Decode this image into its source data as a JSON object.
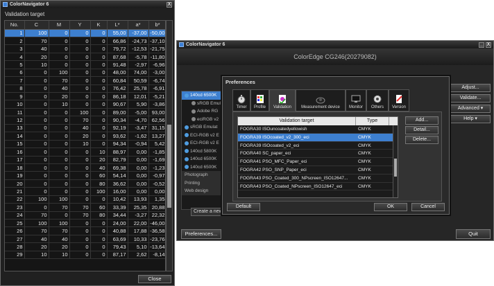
{
  "window_a": {
    "title": "ColorNavigator 6",
    "label": "Validation target",
    "close_label": "Close",
    "min_btn": "_",
    "x_btn": "X",
    "columns": [
      "No.",
      "C",
      "M",
      "Y",
      "K",
      "L*",
      "a*",
      "b*"
    ],
    "rows": [
      [
        "1",
        "100",
        "0",
        "0",
        "0",
        "55,00",
        "-37,00",
        "-50,00"
      ],
      [
        "2",
        "70",
        "0",
        "0",
        "0",
        "66,86",
        "-24,73",
        "-37,10"
      ],
      [
        "3",
        "40",
        "0",
        "0",
        "0",
        "79,72",
        "-12,53",
        "-21,75"
      ],
      [
        "4",
        "20",
        "0",
        "0",
        "0",
        "87,68",
        "-5,78",
        "-11,80"
      ],
      [
        "5",
        "10",
        "0",
        "0",
        "0",
        "91,48",
        "-2,97",
        "-6,96"
      ],
      [
        "6",
        "0",
        "100",
        "0",
        "0",
        "48,00",
        "74,00",
        "-3,00"
      ],
      [
        "7",
        "0",
        "70",
        "0",
        "0",
        "60,84",
        "50,59",
        "-6,74"
      ],
      [
        "8",
        "0",
        "40",
        "0",
        "0",
        "76,42",
        "25,78",
        "-6,91"
      ],
      [
        "9",
        "0",
        "20",
        "0",
        "0",
        "86,18",
        "12,01",
        "-5,21"
      ],
      [
        "10",
        "0",
        "10",
        "0",
        "0",
        "90,67",
        "5,90",
        "-3,86"
      ],
      [
        "11",
        "0",
        "0",
        "100",
        "0",
        "89,00",
        "-5,00",
        "93,00"
      ],
      [
        "12",
        "0",
        "0",
        "70",
        "0",
        "90,34",
        "-4,70",
        "62,56"
      ],
      [
        "13",
        "0",
        "0",
        "40",
        "0",
        "92,19",
        "-3,47",
        "31,15"
      ],
      [
        "14",
        "0",
        "0",
        "20",
        "0",
        "93,62",
        "-1,62",
        "13,27"
      ],
      [
        "15",
        "0",
        "0",
        "10",
        "0",
        "94,34",
        "-0,94",
        "5,42"
      ],
      [
        "16",
        "0",
        "0",
        "0",
        "10",
        "88,97",
        "0,00",
        "-1,85"
      ],
      [
        "17",
        "0",
        "0",
        "0",
        "20",
        "82,79",
        "0,00",
        "-1,69"
      ],
      [
        "18",
        "0",
        "0",
        "0",
        "40",
        "69,38",
        "0,00",
        "-1,23"
      ],
      [
        "19",
        "0",
        "0",
        "0",
        "60",
        "54,14",
        "0,00",
        "-0,97"
      ],
      [
        "20",
        "0",
        "0",
        "0",
        "80",
        "36,62",
        "0,00",
        "-0,52"
      ],
      [
        "21",
        "0",
        "0",
        "0",
        "100",
        "16,00",
        "0,00",
        "0,00"
      ],
      [
        "22",
        "100",
        "100",
        "0",
        "0",
        "10,42",
        "13,93",
        "1,35"
      ],
      [
        "23",
        "0",
        "70",
        "70",
        "60",
        "33,39",
        "25,35",
        "20,88"
      ],
      [
        "24",
        "70",
        "0",
        "70",
        "80",
        "34,44",
        "-3,27",
        "22,32"
      ],
      [
        "25",
        "100",
        "100",
        "0",
        "0",
        "24,00",
        "22,00",
        "-46,00"
      ],
      [
        "26",
        "70",
        "70",
        "0",
        "0",
        "40,88",
        "17,88",
        "-36,58"
      ],
      [
        "27",
        "40",
        "40",
        "0",
        "0",
        "63,69",
        "10,33",
        "-23,76"
      ],
      [
        "28",
        "20",
        "20",
        "0",
        "0",
        "79,43",
        "5,10",
        "-13,64"
      ],
      [
        "29",
        "10",
        "10",
        "0",
        "0",
        "87,17",
        "2,62",
        "-8,14"
      ]
    ]
  },
  "window_b": {
    "title": "ColorNavigator 6",
    "monitor_title": "ColorEdge CG246(20279082)",
    "list_items": [
      {
        "label": "140cd 6500K",
        "kind": "sel"
      },
      {
        "label": "sRGB Emul",
        "kind": "sub"
      },
      {
        "label": "Adobe RG",
        "kind": "sub"
      },
      {
        "label": "eciRGB v2",
        "kind": "sub"
      },
      {
        "label": "sRGB Emulat",
        "kind": "top"
      },
      {
        "label": "ECI-RGB v2 E",
        "kind": "top"
      },
      {
        "label": "ECI-RGB v2 E",
        "kind": "top"
      },
      {
        "label": "140cd 5800K",
        "kind": "top"
      },
      {
        "label": "140cd 6500K",
        "kind": "top"
      },
      {
        "label": "140cd 6500K",
        "kind": "top"
      },
      {
        "label": "Photograph",
        "kind": "plain"
      },
      {
        "label": "Printing",
        "kind": "plain"
      },
      {
        "label": "Web design",
        "kind": "plain"
      }
    ],
    "create_label": "Create a new",
    "right_buttons": [
      "Adjust...",
      "Validate...",
      "Advanced ▾",
      "Help ▾"
    ],
    "preferences_label": "Preferences...",
    "quit_label": "Quit"
  },
  "preferences": {
    "title": "Preferences",
    "tabs": [
      {
        "label": "Timer",
        "icon": "timer-icon"
      },
      {
        "label": "Profile",
        "icon": "profile-icon"
      },
      {
        "label": "Validation",
        "icon": "validation-icon"
      },
      {
        "label": "Measurement device",
        "icon": "measurement-device-icon"
      },
      {
        "label": "Monitor",
        "icon": "monitor-icon"
      },
      {
        "label": "Others",
        "icon": "gear-icon"
      },
      {
        "label": "Version",
        "icon": "version-icon"
      }
    ],
    "table_headers": [
      "Validation target",
      "Type"
    ],
    "targets": [
      [
        "FOGRA30 ISOuncoatedyellowish",
        "CMYK"
      ],
      [
        "FOGRA39 ISOcoated_v2_300_eci",
        "CMYK"
      ],
      [
        "FOGRA39 ISOcoated_v2_eci",
        "CMYK"
      ],
      [
        "FOGRA40 SC_paper_eci",
        "CMYK"
      ],
      [
        "FOGRA41 PSO_MFC_Paper_eci",
        "CMYK"
      ],
      [
        "FOGRA42 PSO_SNP_Paper_eci",
        "CMYK"
      ],
      [
        "FOGRA43 PSO_Coated_300_NPscreen_ISO12647...",
        "CMYK"
      ],
      [
        "FOGRA43 PSO_Coated_NPscreen_ISO12647_eci",
        "CMYK"
      ]
    ],
    "add_label": "Add...",
    "detail_label": "Detail...",
    "delete_label": "Delete...",
    "default_label": "Default",
    "ok_label": "OK",
    "cancel_label": "Cancel"
  },
  "colors": {
    "selection": "#3d7fcf",
    "panel": "#262626",
    "background": "#ffffff"
  }
}
